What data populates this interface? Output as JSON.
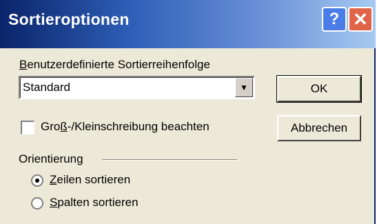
{
  "window": {
    "title": "Sortieroptionen",
    "help_glyph": "?",
    "close_glyph": "✕"
  },
  "sort_order": {
    "label_first": "B",
    "label_rest": "enutzerdefinierte Sortierreihenfolge",
    "selected_value": "Standard",
    "arrow_glyph": "▼"
  },
  "buttons": {
    "ok": "OK",
    "cancel": "Abbrechen"
  },
  "case_sensitive": {
    "checked": false,
    "label_pre": "Gro",
    "label_underlined": "ß",
    "label_post": "-/Kleinschreibung beachten"
  },
  "orientation": {
    "group_label": "Orientierung",
    "options": [
      {
        "underlined": "Z",
        "rest": "eilen sortieren",
        "selected": true
      },
      {
        "underlined": "S",
        "rest": "palten sortieren",
        "selected": false
      }
    ]
  }
}
